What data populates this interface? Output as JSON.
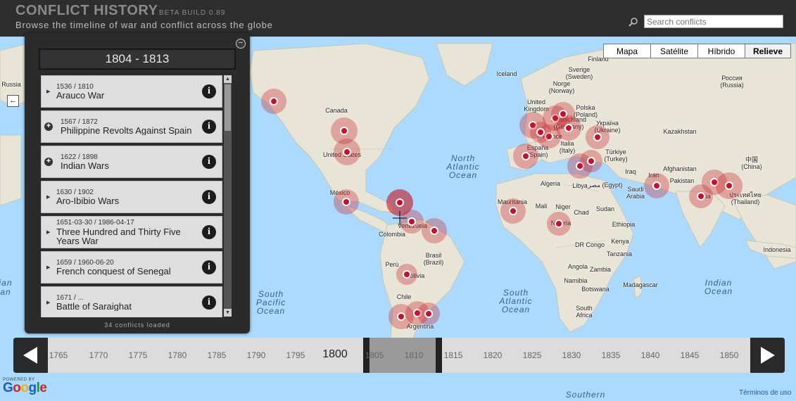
{
  "header": {
    "title": "CONFLICT HISTORY",
    "build": "BETA BUILD 0.89",
    "subtitle": "Browse the timeline of war and conflict across the globe",
    "search_placeholder": "Search conflicts"
  },
  "map_types": [
    "Mapa",
    "Satélite",
    "Híbrido",
    "Relieve"
  ],
  "map_types_active": "Relieve",
  "panel": {
    "range": "1804 - 1813",
    "loaded": "34 conflicts loaded",
    "items": [
      {
        "dates": "1536 / 1810",
        "name": "Arauco War",
        "expander": "triangle"
      },
      {
        "dates": "1567 / 1872",
        "name": "Philippine Revolts Against Spain",
        "expander": "plus"
      },
      {
        "dates": "1622 / 1898",
        "name": "Indian Wars",
        "expander": "plus"
      },
      {
        "dates": "1630 / 1902",
        "name": "Aro-Ibibio Wars",
        "expander": "triangle"
      },
      {
        "dates": "1651-03-30 / 1986-04-17",
        "name": "Three Hundred and Thirty Five Years War",
        "expander": "triangle"
      },
      {
        "dates": "1659 / 1960-06-20",
        "name": "French conquest of Senegal",
        "expander": "triangle"
      },
      {
        "dates": "1671 / ...",
        "name": "Battle of Saraighat",
        "expander": "triangle"
      }
    ]
  },
  "timeline": {
    "ticks": [
      "1765",
      "1770",
      "1775",
      "1780",
      "1785",
      "1790",
      "1795",
      "1800",
      "1805",
      "1810",
      "1815",
      "1820",
      "1825",
      "1830",
      "1835",
      "1840",
      "1845",
      "1850"
    ],
    "major": "1800"
  },
  "map_labels": [
    "Iceland",
    "Sverige (Sweden)",
    "Norge (Norway)",
    "Canada",
    "United Kingdom",
    "Polska (Poland)",
    "Deutschland (Germany)",
    "France",
    "España (Spain)",
    "Italia (Italy)",
    "Україна (Ukraine)",
    "Kazakhstan",
    "Türkiye (Turkey)",
    "Iraq",
    "Iran",
    "Afghanistan",
    "Pakistan",
    "India",
    "中国 (China)",
    "United States",
    "México",
    "Colombia",
    "Venezuela",
    "Brasil (Brazil)",
    "Perú",
    "Bolivia",
    "Chile",
    "Argentina",
    "Algeria",
    "Libya",
    "مصر (Egypt)",
    "Mauritania",
    "Mali",
    "Niger",
    "Chad",
    "Sudan",
    "Nigeria",
    "Ethiopia",
    "DR Congo",
    "Kenya",
    "Tanzania",
    "Angola",
    "Zambia",
    "Namibia",
    "Botswana",
    "South Africa",
    "Madagascar",
    "Saudi Arabia",
    "ประเทศไทย (Thailand)",
    "Indonesia",
    "Россия (Russia)",
    "Finland",
    "Russia"
  ],
  "ocean_labels": [
    "North Atlantic Ocean",
    "South Atlantic Ocean",
    "South Pacific Ocean",
    "Indian Ocean",
    "Southern",
    "ian",
    "an"
  ],
  "footer": {
    "powered_by": "POWERED BY",
    "google": "Google",
    "terms": "Términos de uso"
  },
  "colors": {
    "header_bg": "#2e2e2e",
    "marker": "#c8102e",
    "ocean": "#aadaff",
    "land": "#e8e4d8"
  },
  "icons": [
    "search-icon",
    "collapse-icon",
    "info-icon",
    "expand-plus-icon",
    "triangle-icon",
    "scroll-up-icon",
    "scroll-down-icon",
    "prev-arrow-icon",
    "next-arrow-icon"
  ]
}
